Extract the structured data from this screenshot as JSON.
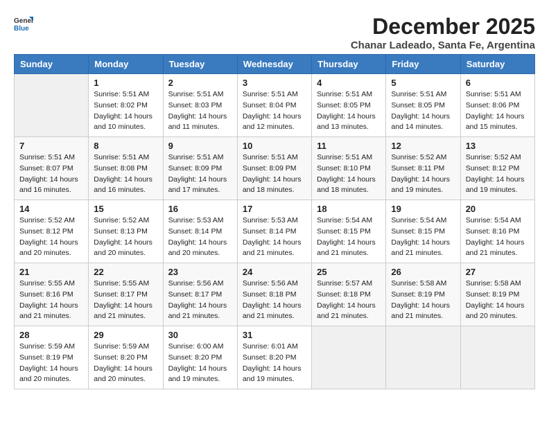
{
  "header": {
    "logo": {
      "general": "General",
      "blue": "Blue"
    },
    "title": "December 2025",
    "subtitle": "Chanar Ladeado, Santa Fe, Argentina"
  },
  "weekdays": [
    "Sunday",
    "Monday",
    "Tuesday",
    "Wednesday",
    "Thursday",
    "Friday",
    "Saturday"
  ],
  "weeks": [
    [
      {
        "day": "",
        "sunrise": "",
        "sunset": "",
        "daylight": ""
      },
      {
        "day": "1",
        "sunrise": "Sunrise: 5:51 AM",
        "sunset": "Sunset: 8:02 PM",
        "daylight": "Daylight: 14 hours and 10 minutes."
      },
      {
        "day": "2",
        "sunrise": "Sunrise: 5:51 AM",
        "sunset": "Sunset: 8:03 PM",
        "daylight": "Daylight: 14 hours and 11 minutes."
      },
      {
        "day": "3",
        "sunrise": "Sunrise: 5:51 AM",
        "sunset": "Sunset: 8:04 PM",
        "daylight": "Daylight: 14 hours and 12 minutes."
      },
      {
        "day": "4",
        "sunrise": "Sunrise: 5:51 AM",
        "sunset": "Sunset: 8:05 PM",
        "daylight": "Daylight: 14 hours and 13 minutes."
      },
      {
        "day": "5",
        "sunrise": "Sunrise: 5:51 AM",
        "sunset": "Sunset: 8:05 PM",
        "daylight": "Daylight: 14 hours and 14 minutes."
      },
      {
        "day": "6",
        "sunrise": "Sunrise: 5:51 AM",
        "sunset": "Sunset: 8:06 PM",
        "daylight": "Daylight: 14 hours and 15 minutes."
      }
    ],
    [
      {
        "day": "7",
        "sunrise": "Sunrise: 5:51 AM",
        "sunset": "Sunset: 8:07 PM",
        "daylight": "Daylight: 14 hours and 16 minutes."
      },
      {
        "day": "8",
        "sunrise": "Sunrise: 5:51 AM",
        "sunset": "Sunset: 8:08 PM",
        "daylight": "Daylight: 14 hours and 16 minutes."
      },
      {
        "day": "9",
        "sunrise": "Sunrise: 5:51 AM",
        "sunset": "Sunset: 8:09 PM",
        "daylight": "Daylight: 14 hours and 17 minutes."
      },
      {
        "day": "10",
        "sunrise": "Sunrise: 5:51 AM",
        "sunset": "Sunset: 8:09 PM",
        "daylight": "Daylight: 14 hours and 18 minutes."
      },
      {
        "day": "11",
        "sunrise": "Sunrise: 5:51 AM",
        "sunset": "Sunset: 8:10 PM",
        "daylight": "Daylight: 14 hours and 18 minutes."
      },
      {
        "day": "12",
        "sunrise": "Sunrise: 5:52 AM",
        "sunset": "Sunset: 8:11 PM",
        "daylight": "Daylight: 14 hours and 19 minutes."
      },
      {
        "day": "13",
        "sunrise": "Sunrise: 5:52 AM",
        "sunset": "Sunset: 8:12 PM",
        "daylight": "Daylight: 14 hours and 19 minutes."
      }
    ],
    [
      {
        "day": "14",
        "sunrise": "Sunrise: 5:52 AM",
        "sunset": "Sunset: 8:12 PM",
        "daylight": "Daylight: 14 hours and 20 minutes."
      },
      {
        "day": "15",
        "sunrise": "Sunrise: 5:52 AM",
        "sunset": "Sunset: 8:13 PM",
        "daylight": "Daylight: 14 hours and 20 minutes."
      },
      {
        "day": "16",
        "sunrise": "Sunrise: 5:53 AM",
        "sunset": "Sunset: 8:14 PM",
        "daylight": "Daylight: 14 hours and 20 minutes."
      },
      {
        "day": "17",
        "sunrise": "Sunrise: 5:53 AM",
        "sunset": "Sunset: 8:14 PM",
        "daylight": "Daylight: 14 hours and 21 minutes."
      },
      {
        "day": "18",
        "sunrise": "Sunrise: 5:54 AM",
        "sunset": "Sunset: 8:15 PM",
        "daylight": "Daylight: 14 hours and 21 minutes."
      },
      {
        "day": "19",
        "sunrise": "Sunrise: 5:54 AM",
        "sunset": "Sunset: 8:15 PM",
        "daylight": "Daylight: 14 hours and 21 minutes."
      },
      {
        "day": "20",
        "sunrise": "Sunrise: 5:54 AM",
        "sunset": "Sunset: 8:16 PM",
        "daylight": "Daylight: 14 hours and 21 minutes."
      }
    ],
    [
      {
        "day": "21",
        "sunrise": "Sunrise: 5:55 AM",
        "sunset": "Sunset: 8:16 PM",
        "daylight": "Daylight: 14 hours and 21 minutes."
      },
      {
        "day": "22",
        "sunrise": "Sunrise: 5:55 AM",
        "sunset": "Sunset: 8:17 PM",
        "daylight": "Daylight: 14 hours and 21 minutes."
      },
      {
        "day": "23",
        "sunrise": "Sunrise: 5:56 AM",
        "sunset": "Sunset: 8:17 PM",
        "daylight": "Daylight: 14 hours and 21 minutes."
      },
      {
        "day": "24",
        "sunrise": "Sunrise: 5:56 AM",
        "sunset": "Sunset: 8:18 PM",
        "daylight": "Daylight: 14 hours and 21 minutes."
      },
      {
        "day": "25",
        "sunrise": "Sunrise: 5:57 AM",
        "sunset": "Sunset: 8:18 PM",
        "daylight": "Daylight: 14 hours and 21 minutes."
      },
      {
        "day": "26",
        "sunrise": "Sunrise: 5:58 AM",
        "sunset": "Sunset: 8:19 PM",
        "daylight": "Daylight: 14 hours and 21 minutes."
      },
      {
        "day": "27",
        "sunrise": "Sunrise: 5:58 AM",
        "sunset": "Sunset: 8:19 PM",
        "daylight": "Daylight: 14 hours and 20 minutes."
      }
    ],
    [
      {
        "day": "28",
        "sunrise": "Sunrise: 5:59 AM",
        "sunset": "Sunset: 8:19 PM",
        "daylight": "Daylight: 14 hours and 20 minutes."
      },
      {
        "day": "29",
        "sunrise": "Sunrise: 5:59 AM",
        "sunset": "Sunset: 8:20 PM",
        "daylight": "Daylight: 14 hours and 20 minutes."
      },
      {
        "day": "30",
        "sunrise": "Sunrise: 6:00 AM",
        "sunset": "Sunset: 8:20 PM",
        "daylight": "Daylight: 14 hours and 19 minutes."
      },
      {
        "day": "31",
        "sunrise": "Sunrise: 6:01 AM",
        "sunset": "Sunset: 8:20 PM",
        "daylight": "Daylight: 14 hours and 19 minutes."
      },
      {
        "day": "",
        "sunrise": "",
        "sunset": "",
        "daylight": ""
      },
      {
        "day": "",
        "sunrise": "",
        "sunset": "",
        "daylight": ""
      },
      {
        "day": "",
        "sunrise": "",
        "sunset": "",
        "daylight": ""
      }
    ]
  ]
}
